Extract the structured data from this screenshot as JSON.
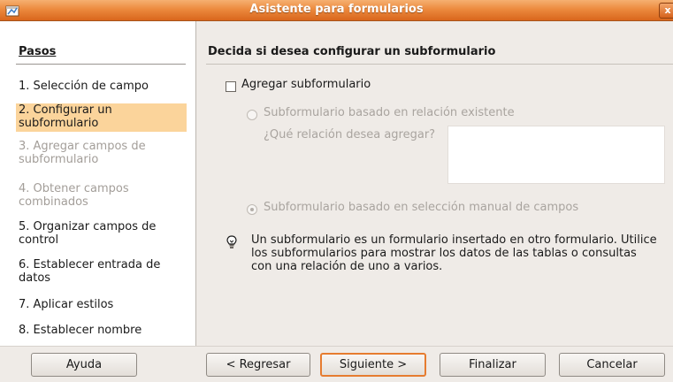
{
  "window": {
    "title": "Asistente para formularios",
    "close_label": "x"
  },
  "sidebar": {
    "title": "Pasos",
    "steps": [
      {
        "label": "1. Selección de campo",
        "state": "normal"
      },
      {
        "label": "2. Configurar un subformulario",
        "state": "active"
      },
      {
        "label": "3. Agregar campos de subformulario",
        "state": "disabled"
      },
      {
        "label": "4. Obtener campos combinados",
        "state": "disabled"
      },
      {
        "label": "5. Organizar campos de control",
        "state": "normal"
      },
      {
        "label": "6. Establecer entrada de datos",
        "state": "normal"
      },
      {
        "label": "7. Aplicar estilos",
        "state": "normal"
      },
      {
        "label": "8. Establecer nombre",
        "state": "normal"
      }
    ]
  },
  "main": {
    "heading": "Decida si desea configurar un subformulario",
    "add_subform": {
      "label": "Agregar subformulario",
      "checked": false
    },
    "radio_existing": {
      "label": "Subformulario basado en relación existente",
      "selected": false,
      "enabled": false
    },
    "relation_prompt": "¿Qué relación desea agregar?",
    "radio_manual": {
      "label": "Subformulario basado en selección manual de campos",
      "selected": true,
      "enabled": false
    },
    "info_text": "Un subformulario es un formulario insertado en otro formulario. Utilice los subformularios para mostrar los datos de las tablas o consultas con una relación de uno a varios."
  },
  "buttons": {
    "help": "Ayuda",
    "back": "< Regresar",
    "next": "Siguiente >",
    "finish": "Finalizar",
    "cancel": "Cancelar"
  },
  "colors": {
    "titlebar": "#e5803a",
    "active_step": "#fbd49b",
    "default_button_border": "#e67c30"
  }
}
